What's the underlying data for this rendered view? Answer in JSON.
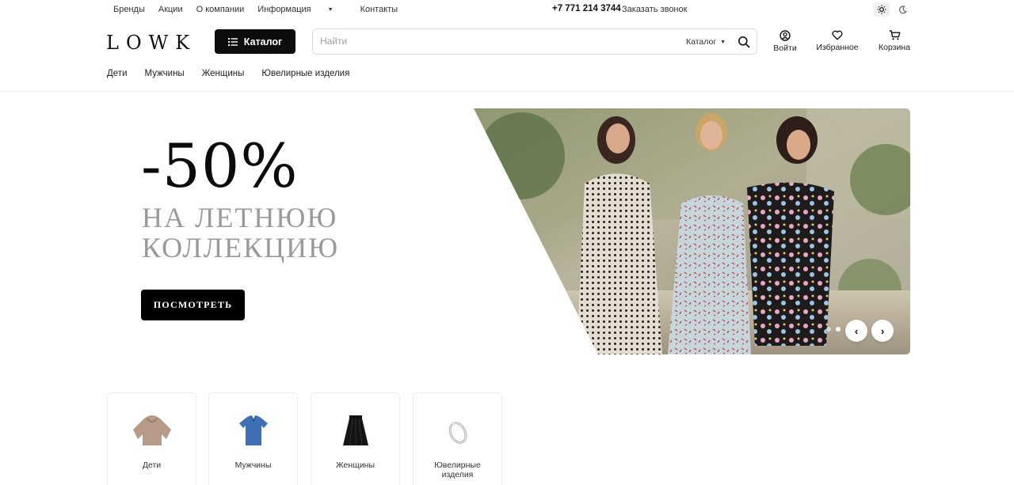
{
  "topbar": {
    "links": [
      "Бренды",
      "Акции",
      "О компании",
      "Информация",
      "Контакты"
    ],
    "phone": "+7 771 214 3744",
    "callback": "Заказать звонок"
  },
  "header": {
    "logo": "LOWK",
    "catalog_button": "Каталог",
    "search_placeholder": "Найти",
    "search_scope": "Каталог",
    "login": "Войти",
    "favorites": "Избранное",
    "cart": "Корзина"
  },
  "category_nav": [
    "Дети",
    "Мужчины",
    "Женщины",
    "Ювелирные изделия"
  ],
  "hero": {
    "discount": "-50%",
    "line1": "НА ЛЕТНЮЮ",
    "line2": "КОЛЛЕКЦИЮ",
    "button": "ПОСМОТРЕТЬ",
    "slides_total": 2,
    "slide_active": 2
  },
  "tiles": [
    {
      "label": "Дети",
      "icon": "hoodie-icon"
    },
    {
      "label": "Мужчины",
      "icon": "polo-shirt-icon"
    },
    {
      "label": "Женщины",
      "icon": "skirt-icon"
    },
    {
      "label": "Ювелирные изделия",
      "icon": "ring-icon"
    }
  ],
  "colors": {
    "accent": "#0d0d0d",
    "muted": "#9a9a9a"
  }
}
